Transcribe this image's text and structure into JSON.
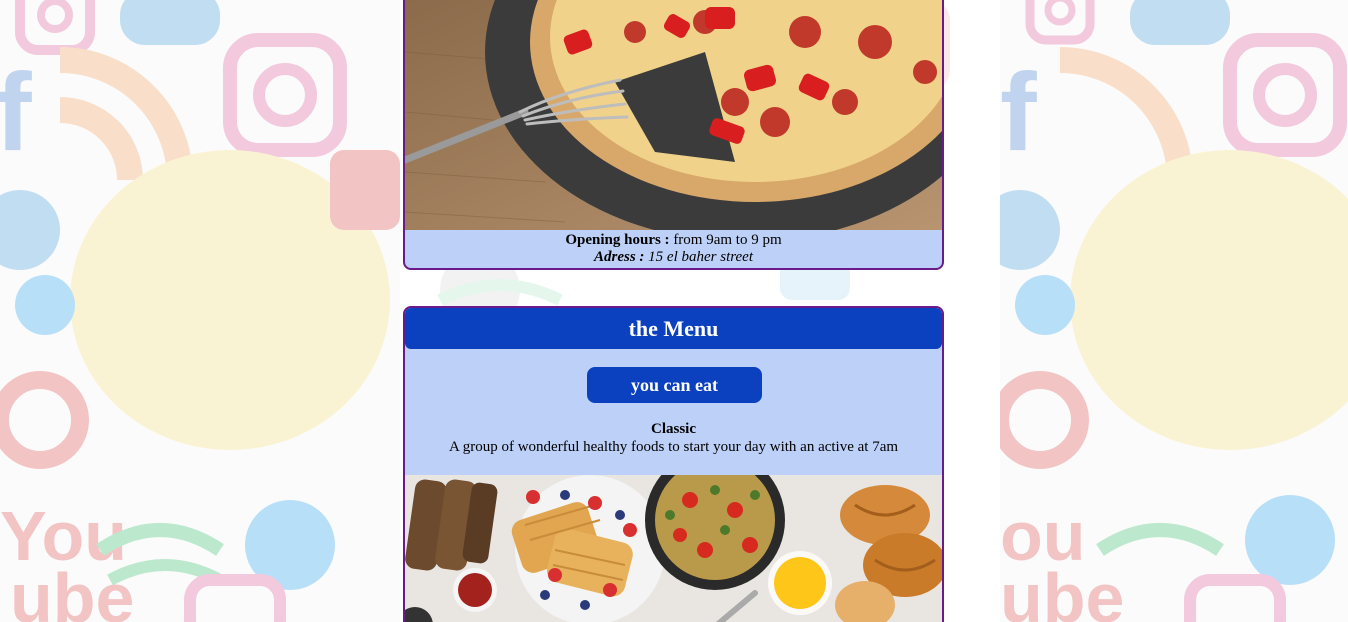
{
  "venue": {
    "opening_hours_label": "Opening hours :",
    "opening_hours_value": "from 9am to 9 pm",
    "address_label": "Adress :",
    "address_value": "15 el baher street"
  },
  "menu": {
    "header": "the Menu",
    "button_label": "you can eat",
    "item_title": "Classic",
    "item_description": "A group of wonderful healthy foods to start your day with an active at 7am"
  },
  "colors": {
    "card_background": "#bdd0f7",
    "card_border": "#6a1a8a",
    "accent_blue": "#0b40bf"
  }
}
